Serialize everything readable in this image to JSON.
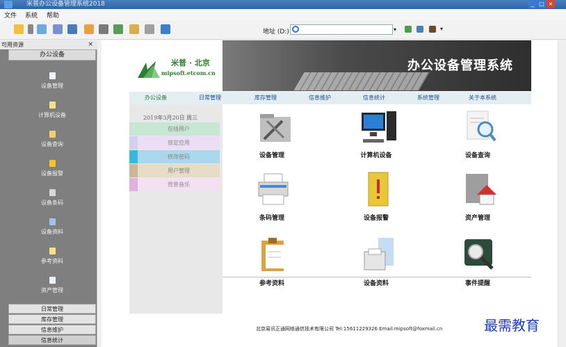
{
  "window": {
    "title": "米普办公设备管理系统2018"
  },
  "menu": [
    "文件",
    "系统",
    "帮助"
  ],
  "toolbar": {
    "address_label": "地址 (D:)",
    "address_value": ""
  },
  "sidebar": {
    "header": "可用资源",
    "close": "×",
    "group": "办公设备",
    "items": [
      {
        "label": "设备管理"
      },
      {
        "label": "计算机设备"
      },
      {
        "label": "设备查询"
      },
      {
        "label": "设备报警"
      },
      {
        "label": "设备条码"
      },
      {
        "label": "设备资料"
      },
      {
        "label": "参考资料"
      },
      {
        "label": "资产管理"
      }
    ],
    "categories": [
      "日常管理",
      "库存管理",
      "信息维护",
      "信息统计"
    ]
  },
  "header": {
    "logo_cn": "米普 · 北京",
    "logo_url": "mipsoft.etcom.cn",
    "banner_title": "办公设备管理系统"
  },
  "nav": [
    "办公设备",
    "日常管理",
    "库存管理",
    "信息维护",
    "信息统计",
    "系统管理",
    "关于本系统"
  ],
  "left_panel": {
    "date": "2019年3月20日 周三",
    "items": [
      {
        "label": "在线用户",
        "color": "#c8e6d4"
      },
      {
        "label": "锁定应用",
        "color": "#cfd2ee"
      },
      {
        "label": "修改密码",
        "color": "#a9d8ec"
      },
      {
        "label": "用户管理",
        "color": "#e6dcc8"
      },
      {
        "label": "背景音乐",
        "color": "#eccfe8"
      }
    ]
  },
  "tiles": [
    {
      "label": "设备管理",
      "icon": "tools-folder-icon"
    },
    {
      "label": "计算机设备",
      "icon": "computer-icon"
    },
    {
      "label": "设备查询",
      "icon": "magnifier-doc-icon"
    },
    {
      "label": "条码管理",
      "icon": "printer-icon"
    },
    {
      "label": "设备报警",
      "icon": "alert-book-icon"
    },
    {
      "label": "资产管理",
      "icon": "house-folder-icon"
    },
    {
      "label": "参考资料",
      "icon": "clipboard-icon"
    },
    {
      "label": "设备资料",
      "icon": "fax-icon"
    },
    {
      "label": "事件提醒",
      "icon": "clock-magnifier-icon"
    }
  ],
  "footer": "北京易讯正通网络通信技术有限公司  Tel:15611229326  Email:mipsoft@foxmail.cn",
  "watermark": "最需教育"
}
